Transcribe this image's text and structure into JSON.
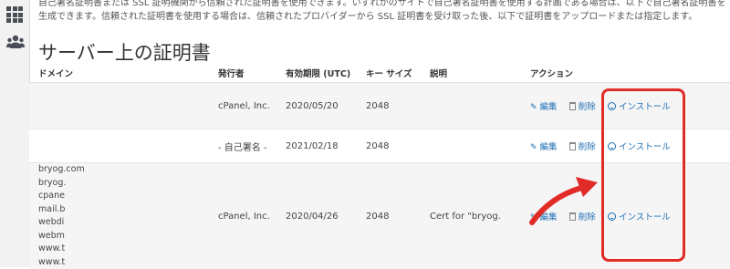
{
  "intro_text": "自己署名証明書または SSL 証明機関から信頼された証明書を使用できます。いずれかのサイトで自己署名証明書を使用する計画である場合は、以下で自己署名証明書を生成できます。信頼された証明書を使用する場合は、信頼されたプロバイダーから SSL 証明書を受け取った後、以下で証明書をアップロードまたは指定します。",
  "page_title": "サーバー上の証明書",
  "table": {
    "headers": [
      "ドメイン",
      "発行者",
      "有効期限 (UTC)",
      "キー サイズ",
      "説明",
      "アクション"
    ],
    "rows": [
      {
        "domains": "",
        "issuer": "cPanel, Inc.",
        "expiry": "2020/05/20",
        "key_size": "2048",
        "description": ""
      },
      {
        "domains": "",
        "issuer": "- 自己署名 -",
        "expiry": "2021/02/18",
        "key_size": "2048",
        "description": ""
      },
      {
        "domains": "bryog.com\nbryog.\ncpane\nmail.b\nwebdi\nwebm\nwww.t\nwww.t",
        "issuer": "cPanel, Inc.",
        "expiry": "2020/04/26",
        "key_size": "2048",
        "description": "Cert for \"bryog."
      }
    ]
  },
  "actions": {
    "edit": "編集",
    "delete": "削除",
    "install": "インストール"
  },
  "icons": {
    "sidebar": [
      "grid-icon",
      "users-icon"
    ],
    "edit": "pencil-icon",
    "delete": "trash-icon",
    "install": "download-circle-icon"
  },
  "colors": {
    "link": "#1f6fb5",
    "highlight": "#e02b27"
  }
}
